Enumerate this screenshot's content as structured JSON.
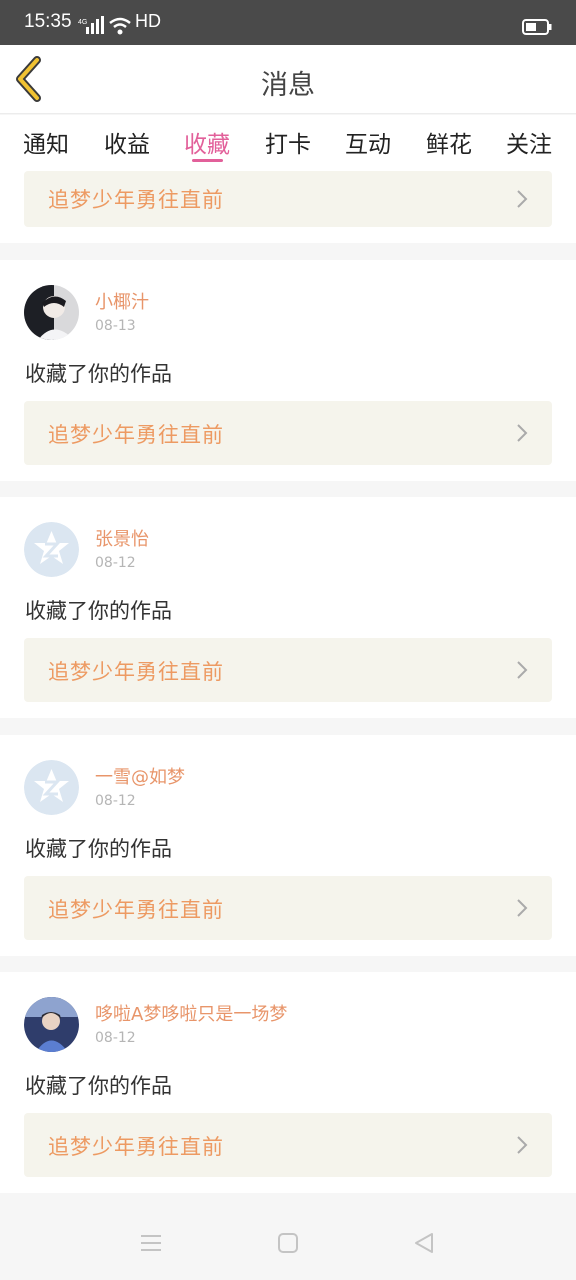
{
  "status_bar": {
    "time": "15:35",
    "network": "4G",
    "hd": "HD"
  },
  "header": {
    "title": "消息"
  },
  "tabs": [
    {
      "label": "通知"
    },
    {
      "label": "收益"
    },
    {
      "label": "收藏",
      "active": true
    },
    {
      "label": "打卡"
    },
    {
      "label": "互动"
    },
    {
      "label": "鲜花"
    },
    {
      "label": "关注"
    }
  ],
  "top_work": {
    "title": "追梦少年勇往直前"
  },
  "messages": [
    {
      "user": "小椰汁",
      "date": "08-13",
      "action": "收藏了你的作品",
      "work_title": "追梦少年勇往直前",
      "avatar": "photo-avatar"
    },
    {
      "user": "张景怡",
      "date": "08-12",
      "action": "收藏了你的作品",
      "work_title": "追梦少年勇往直前",
      "avatar": "default-qq-avatar"
    },
    {
      "user": "一雪@如梦",
      "date": "08-12",
      "action": "收藏了你的作品",
      "work_title": "追梦少年勇往直前",
      "avatar": "default-qq-avatar"
    },
    {
      "user": "哆啦A梦哆啦只是一场梦",
      "date": "08-12",
      "action": "收藏了你的作品",
      "work_title": "追梦少年勇往直前",
      "avatar": "photo-avatar"
    }
  ],
  "colors": {
    "accent": "#e2609a",
    "username": "#e8956a",
    "work_title": "#ed9a62",
    "work_bg": "#f5f4ec",
    "back_icon": "#f1c232"
  }
}
